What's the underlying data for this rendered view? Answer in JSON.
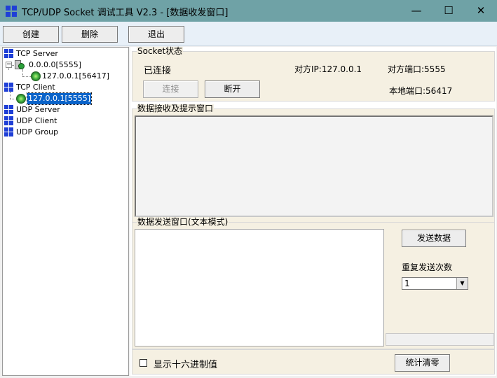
{
  "window": {
    "title": "TCP/UDP Socket 调试工具 V2.3 - [数据收发窗口]",
    "controls": {
      "minimize": "—",
      "maximize": "☐",
      "close": "✕"
    }
  },
  "toolbar": {
    "create": "创建",
    "delete": "删除",
    "exit": "退出"
  },
  "tree": {
    "tcp_server": "TCP Server",
    "tcp_server_listen": "0.0.0.0[5555]",
    "tcp_server_conn": "127.0.0.1[56417]",
    "tcp_client": "TCP Client",
    "tcp_client_conn": "127.0.0.1[5555]",
    "udp_server": "UDP Server",
    "udp_client": "UDP Client",
    "udp_group": "UDP Group"
  },
  "socket_status": {
    "label": "Socket状态",
    "state": "已连接",
    "remote_ip": "对方IP:127.0.0.1",
    "remote_port": "对方端口:5555",
    "local_port": "本地端口:56417",
    "connect_button": "连接",
    "disconnect_button": "断开"
  },
  "receive": {
    "label": "数据接收及提示窗口",
    "content": ""
  },
  "send": {
    "label": "数据发送窗口(文本模式)",
    "content": "",
    "send_button": "发送数据",
    "repeat_label": "重复发送次数",
    "repeat_value": "1"
  },
  "footer": {
    "hex_label": "显示十六进制值",
    "clear_stats_button": "统计清零"
  }
}
